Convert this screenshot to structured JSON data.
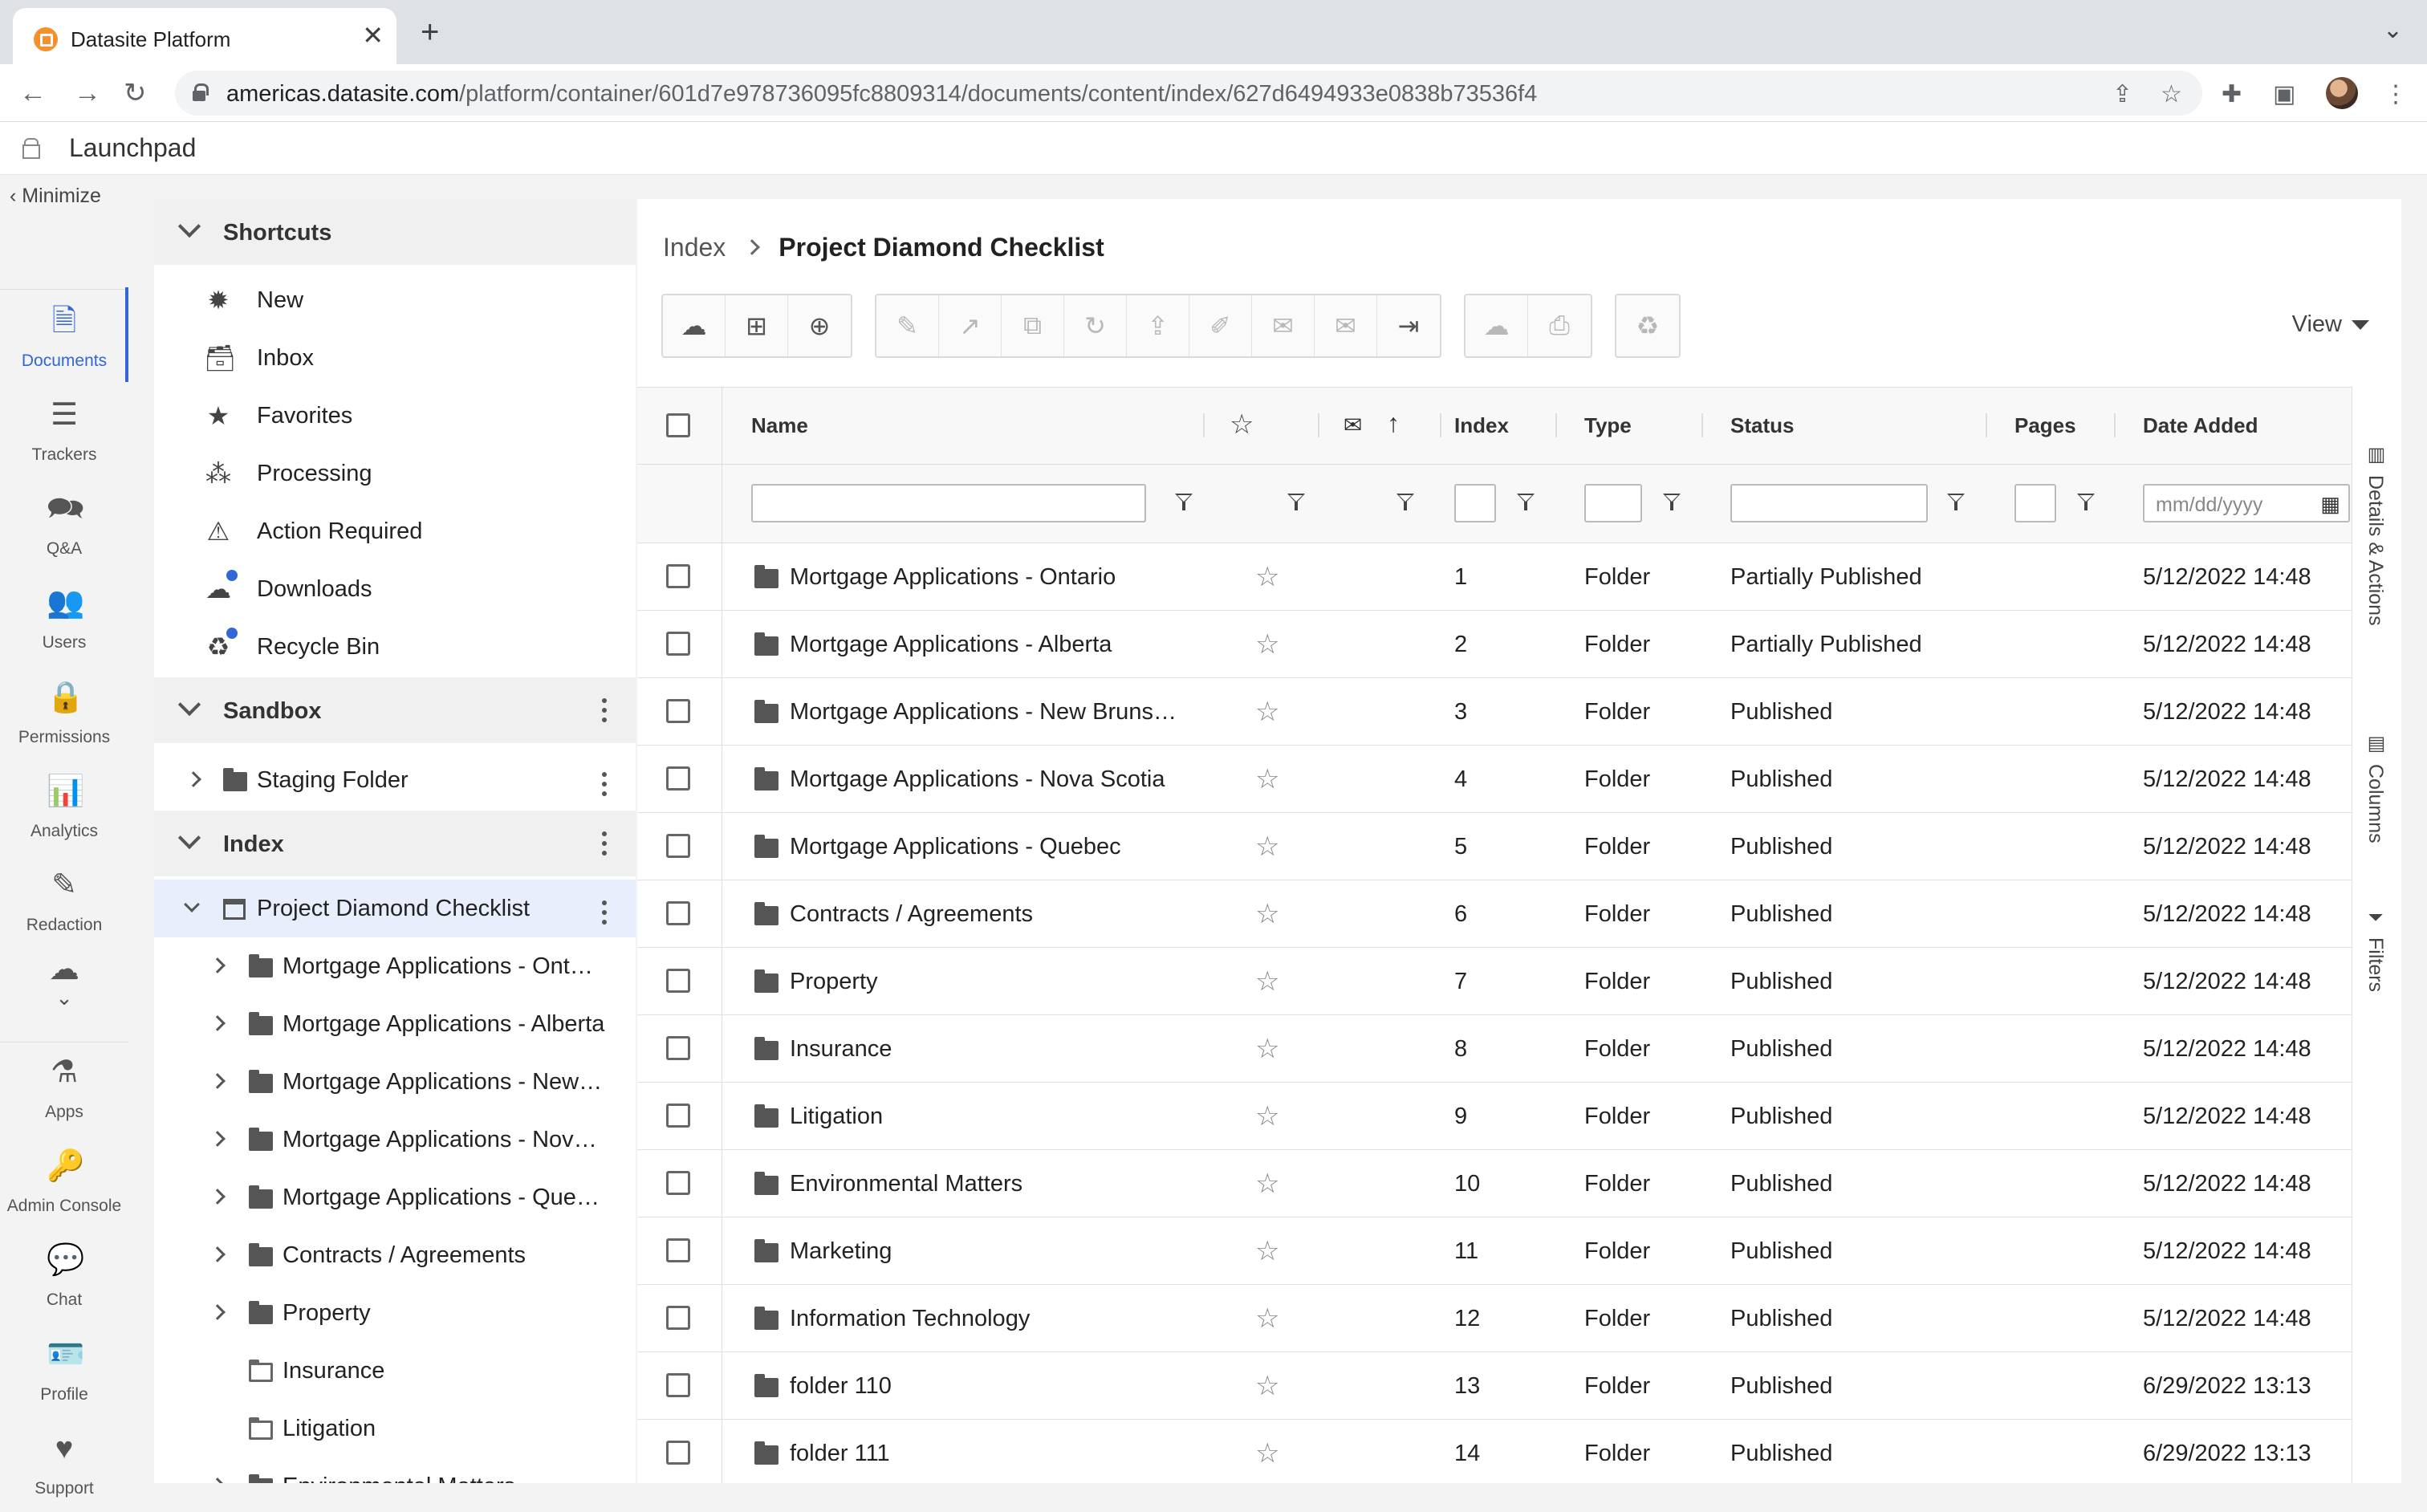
{
  "browser": {
    "tab_title": "Datasite Platform",
    "url_host": "americas.datasite.com",
    "url_path": "/platform/container/601d7e978736095fc8809314/documents/content/index/627d6494933e0838b73536f4"
  },
  "launchpad": {
    "title": "Launchpad"
  },
  "rail": {
    "minimize_label": "Minimize",
    "items": [
      {
        "label": "Documents",
        "icon": "document-icon"
      },
      {
        "label": "Trackers",
        "icon": "checklist-icon"
      },
      {
        "label": "Q&A",
        "icon": "chat-bubbles-icon"
      },
      {
        "label": "Users",
        "icon": "users-icon"
      },
      {
        "label": "Permissions",
        "icon": "lock-icon"
      },
      {
        "label": "Analytics",
        "icon": "chart-icon"
      },
      {
        "label": "Redaction",
        "icon": "marker-icon"
      },
      {
        "label": "Apps",
        "icon": "flask-icon"
      },
      {
        "label": "Admin Console",
        "icon": "key-icon"
      },
      {
        "label": "Chat",
        "icon": "chat-icon"
      },
      {
        "label": "Profile",
        "icon": "id-card-icon"
      },
      {
        "label": "Support",
        "icon": "support-icon"
      }
    ]
  },
  "tree": {
    "shortcuts_title": "Shortcuts",
    "shortcuts": [
      {
        "label": "New",
        "icon": "new-badge-icon"
      },
      {
        "label": "Inbox",
        "icon": "inbox-icon"
      },
      {
        "label": "Favorites",
        "icon": "star-icon"
      },
      {
        "label": "Processing",
        "icon": "spinner-icon"
      },
      {
        "label": "Action Required",
        "icon": "warning-icon"
      },
      {
        "label": "Downloads",
        "icon": "cloud-download-icon"
      },
      {
        "label": "Recycle Bin",
        "icon": "recycle-icon"
      }
    ],
    "sandbox_title": "Sandbox",
    "staging_folder": "Staging Folder",
    "index_title": "Index",
    "project": "Project Diamond Checklist",
    "children": [
      "Mortgage Applications - Ontario",
      "Mortgage Applications - Alberta",
      "Mortgage Applications - New Brunswick",
      "Mortgage Applications - Nova Scotia",
      "Mortgage Applications - Quebec",
      "Contracts / Agreements",
      "Property",
      "Insurance",
      "Litigation",
      "Environmental Matters"
    ]
  },
  "main": {
    "breadcrumb_root": "Index",
    "breadcrumb_current": "Project Diamond Checklist",
    "view_label": "View",
    "columns": {
      "name": "Name",
      "index": "Index",
      "type": "Type",
      "status": "Status",
      "pages": "Pages",
      "date_added": "Date Added"
    },
    "date_placeholder": "mm/dd/yyyy",
    "rows": [
      {
        "name": "Mortgage Applications - Ontario",
        "index": "1",
        "type": "Folder",
        "status": "Partially Published",
        "date": "5/12/2022 14:48"
      },
      {
        "name": "Mortgage Applications - Alberta",
        "index": "2",
        "type": "Folder",
        "status": "Partially Published",
        "date": "5/12/2022 14:48"
      },
      {
        "name": "Mortgage Applications - New Brunswick",
        "index": "3",
        "type": "Folder",
        "status": "Published",
        "date": "5/12/2022 14:48"
      },
      {
        "name": "Mortgage Applications - Nova Scotia",
        "index": "4",
        "type": "Folder",
        "status": "Published",
        "date": "5/12/2022 14:48"
      },
      {
        "name": "Mortgage Applications - Quebec",
        "index": "5",
        "type": "Folder",
        "status": "Published",
        "date": "5/12/2022 14:48"
      },
      {
        "name": "Contracts / Agreements",
        "index": "6",
        "type": "Folder",
        "status": "Published",
        "date": "5/12/2022 14:48"
      },
      {
        "name": "Property",
        "index": "7",
        "type": "Folder",
        "status": "Published",
        "date": "5/12/2022 14:48"
      },
      {
        "name": "Insurance",
        "index": "8",
        "type": "Folder",
        "status": "Published",
        "date": "5/12/2022 14:48"
      },
      {
        "name": "Litigation",
        "index": "9",
        "type": "Folder",
        "status": "Published",
        "date": "5/12/2022 14:48"
      },
      {
        "name": "Environmental Matters",
        "index": "10",
        "type": "Folder",
        "status": "Published",
        "date": "5/12/2022 14:48"
      },
      {
        "name": "Marketing",
        "index": "11",
        "type": "Folder",
        "status": "Published",
        "date": "5/12/2022 14:48"
      },
      {
        "name": "Information Technology",
        "index": "12",
        "type": "Folder",
        "status": "Published",
        "date": "5/12/2022 14:48"
      },
      {
        "name": "folder 110",
        "index": "13",
        "type": "Folder",
        "status": "Published",
        "date": "6/29/2022 13:13"
      },
      {
        "name": "folder 111",
        "index": "14",
        "type": "Folder",
        "status": "Published",
        "date": "6/29/2022 13:13"
      }
    ],
    "side_tabs": [
      "Details & Actions",
      "Columns",
      "Filters"
    ]
  },
  "colors": {
    "accent": "#3367d6",
    "favicon": "#f4902d"
  }
}
